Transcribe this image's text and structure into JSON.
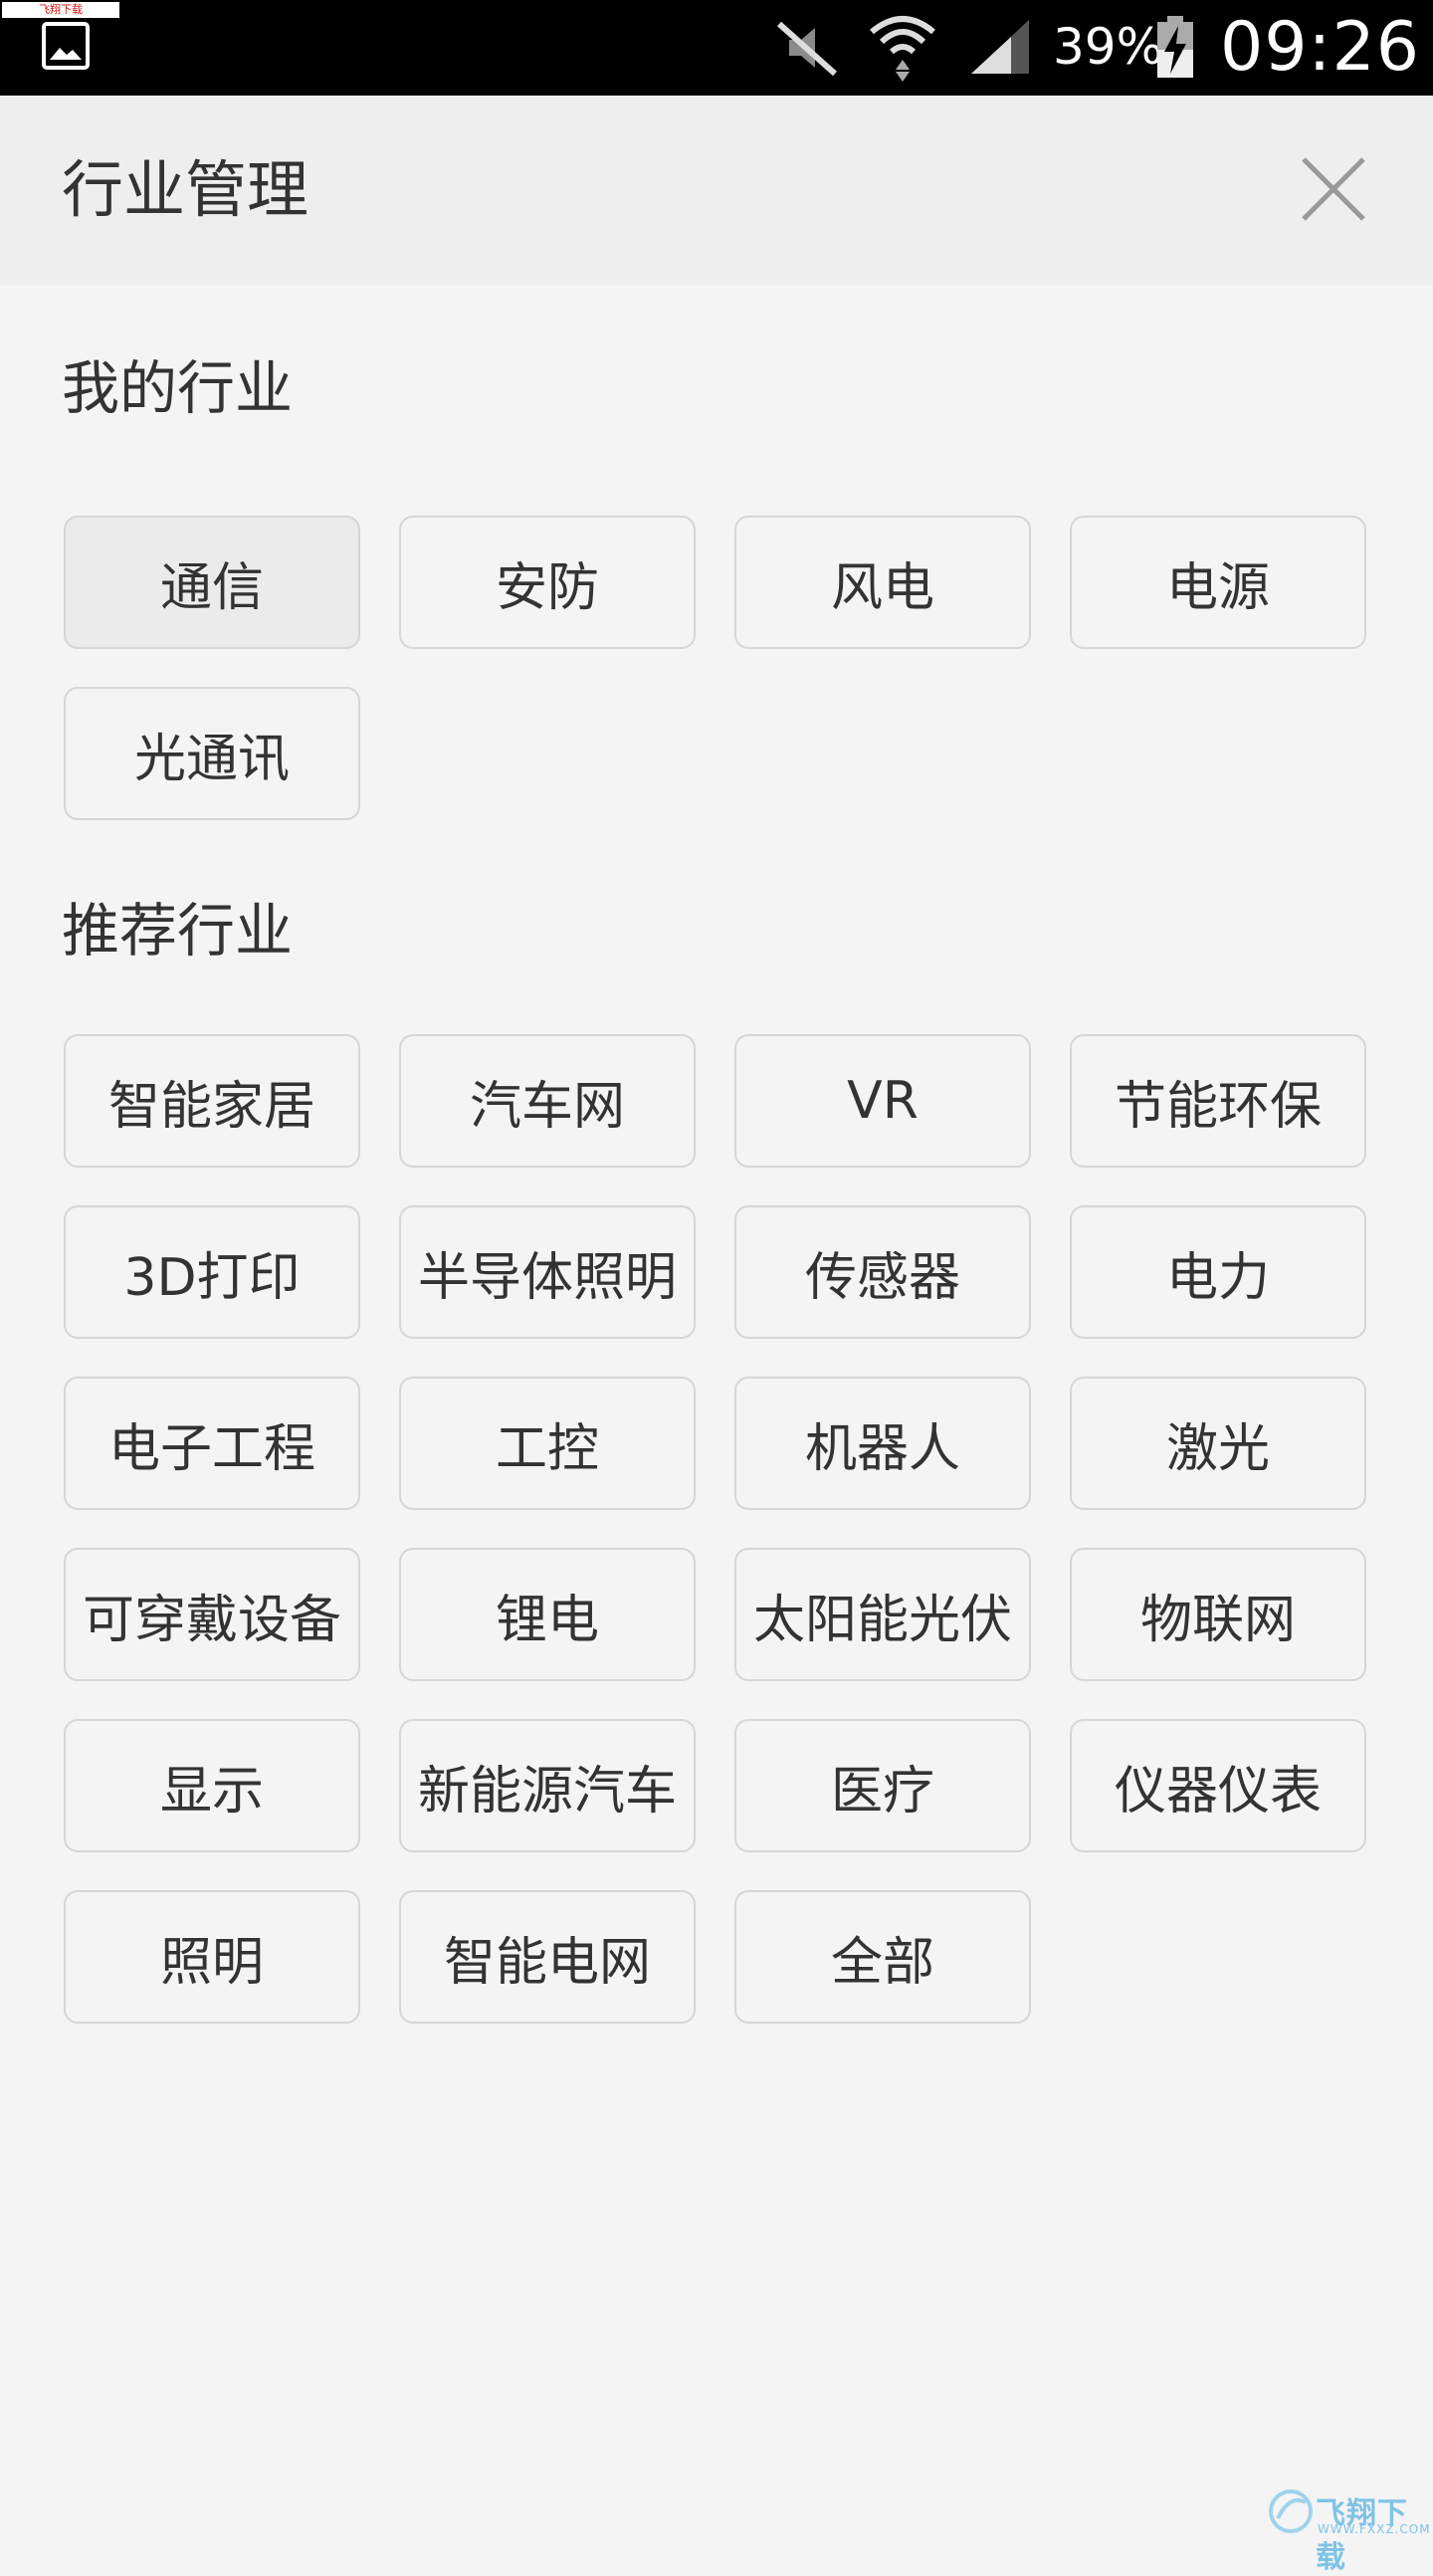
{
  "status_bar": {
    "watermark": "飞翔下载 www.FXXZ.com",
    "battery_percent": "39%",
    "time": "09:26"
  },
  "header": {
    "title": "行业管理",
    "close_icon": "close-icon"
  },
  "my_section": {
    "title": "我的行业",
    "items": [
      "通信",
      "安防",
      "风电",
      "电源",
      "光通讯"
    ],
    "selected_index": 0
  },
  "recommended_section": {
    "title": "推荐行业",
    "items": [
      "智能家居",
      "汽车网",
      "VR",
      "节能环保",
      "3D打印",
      "半导体照明",
      "传感器",
      "电力",
      "电子工程",
      "工控",
      "机器人",
      "激光",
      "可穿戴设备",
      "锂电",
      "太阳能光伏",
      "物联网",
      "显示",
      "新能源汽车",
      "医疗",
      "仪器仪表",
      "照明",
      "智能电网",
      "全部"
    ]
  },
  "logo_watermark": {
    "text": "飞翔下载",
    "sub": "WWW.FXXZ.COM"
  },
  "colors": {
    "status_bar_bg": "#000000",
    "header_bg": "#eeeeee",
    "page_bg": "#f4f4f4",
    "chip_border": "#d6d6d6",
    "selected_chip_bg": "#ebebeb"
  }
}
